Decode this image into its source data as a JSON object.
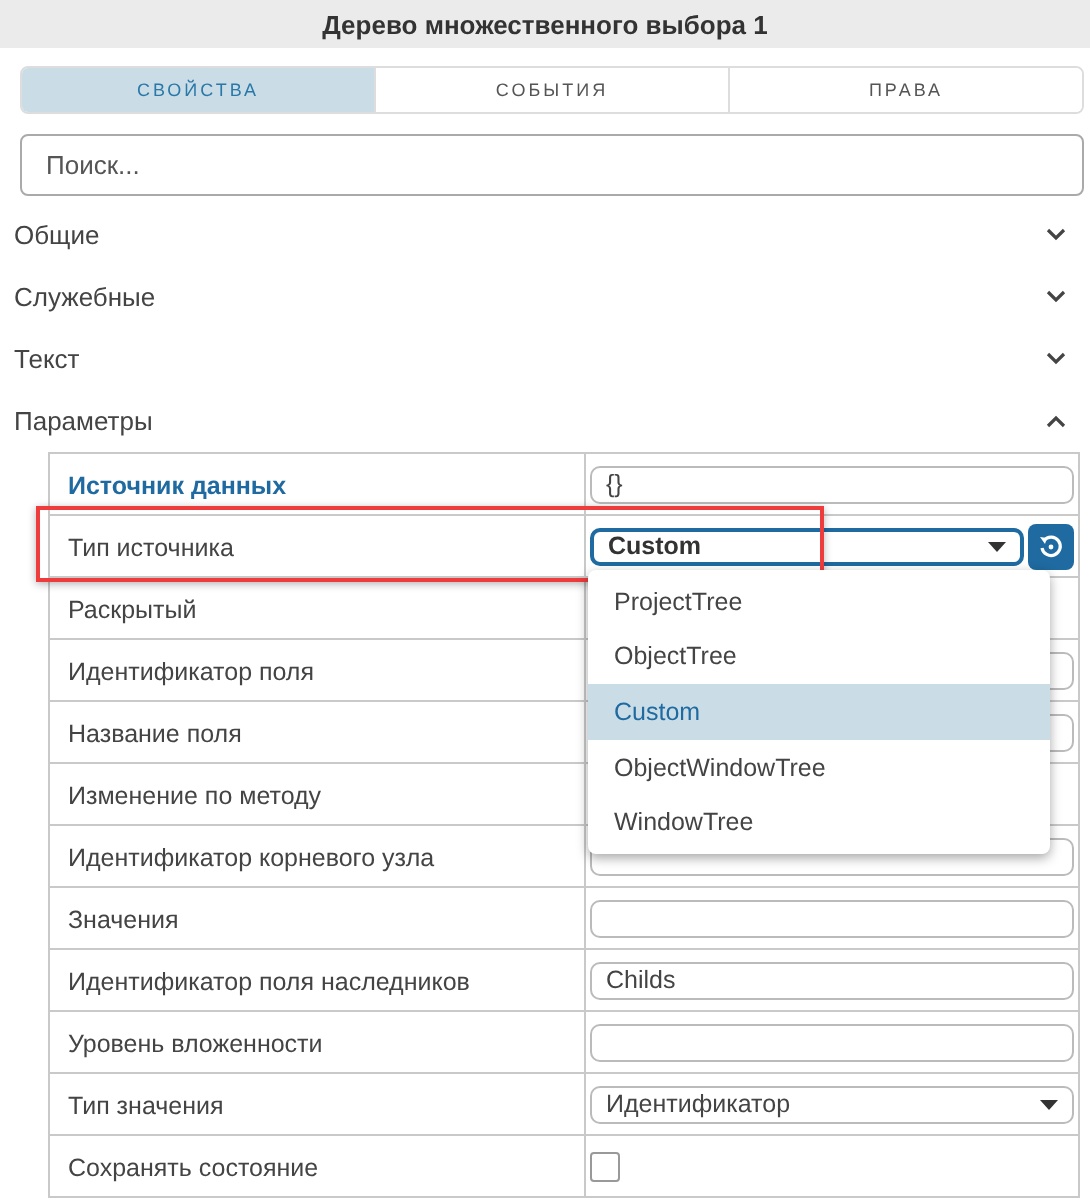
{
  "window": {
    "title": "Дерево множественного выбора 1"
  },
  "tabs": [
    {
      "label": "СВОЙСТВА",
      "selected": true
    },
    {
      "label": "СОБЫТИЯ",
      "selected": false
    },
    {
      "label": "ПРАВА",
      "selected": false
    }
  ],
  "search": {
    "placeholder": "Поиск..."
  },
  "sections": [
    {
      "title": "Общие",
      "expanded": false
    },
    {
      "title": "Служебные",
      "expanded": false
    },
    {
      "title": "Текст",
      "expanded": false
    },
    {
      "title": "Параметры",
      "expanded": true
    }
  ],
  "properties": [
    {
      "label": "Источник данных",
      "kind": "text",
      "value": "{}",
      "emphasized": true,
      "highlighted": false
    },
    {
      "label": "Тип источника",
      "kind": "select",
      "value": "Custom",
      "emphasized": false,
      "highlighted": true,
      "open": true,
      "options": [
        {
          "label": "ProjectTree",
          "selected": false
        },
        {
          "label": "ObjectTree",
          "selected": false
        },
        {
          "label": "Custom",
          "selected": true
        },
        {
          "label": "ObjectWindowTree",
          "selected": false
        },
        {
          "label": "WindowTree",
          "selected": false
        }
      ]
    },
    {
      "label": "Раскрытый",
      "kind": "none",
      "emphasized": false,
      "highlighted": false
    },
    {
      "label": "Идентификатор поля",
      "kind": "text",
      "emphasized": false,
      "highlighted": false
    },
    {
      "label": "Название поля",
      "kind": "text",
      "emphasized": false,
      "highlighted": false
    },
    {
      "label": "Изменение по методу",
      "kind": "none",
      "emphasized": false,
      "highlighted": false
    },
    {
      "label": "Идентификатор корневого узла",
      "kind": "text",
      "emphasized": false,
      "highlighted": false
    },
    {
      "label": "Значения",
      "kind": "text",
      "emphasized": false,
      "highlighted": false
    },
    {
      "label": "Идентификатор поля наследников",
      "kind": "text",
      "value": "Childs",
      "emphasized": false,
      "highlighted": false
    },
    {
      "label": "Уровень вложенности",
      "kind": "text",
      "emphasized": false,
      "highlighted": false
    },
    {
      "label": "Тип значения",
      "kind": "select",
      "value": "Идентификатор",
      "emphasized": false,
      "highlighted": false,
      "open": false
    },
    {
      "label": "Сохранять состояние",
      "kind": "checkbox",
      "checked": false,
      "emphasized": false,
      "highlighted": false
    }
  ]
}
